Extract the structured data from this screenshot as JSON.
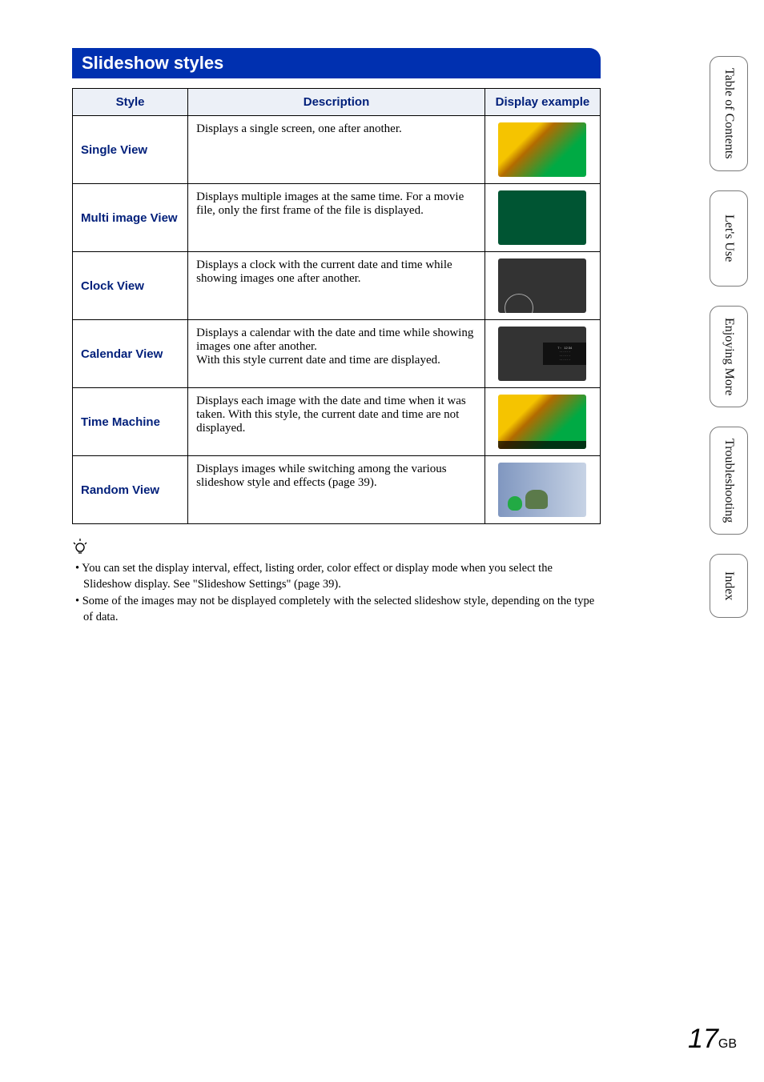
{
  "section_title": "Slideshow styles",
  "table": {
    "headers": {
      "style": "Style",
      "description": "Description",
      "example": "Display example"
    },
    "rows": [
      {
        "style": "Single View",
        "description": "Displays a single screen, one after another.",
        "thumb": "sunflower"
      },
      {
        "style": "Multi image View",
        "description": "Displays multiple images at the same time. For a movie file, only the first frame of the file is displayed.",
        "thumb": "multi"
      },
      {
        "style": "Clock View",
        "description": "Displays a clock with the current date and time while showing images one after another.",
        "thumb": "clock"
      },
      {
        "style": "Calendar View",
        "description": "Displays a calendar with the date and time while showing images one after another.\nWith this style current date and time are displayed.",
        "thumb": "calendar"
      },
      {
        "style": "Time Machine",
        "description": "Displays each image with the date and time when it was taken. With this style, the current date and time are not displayed.",
        "thumb": "time"
      },
      {
        "style": "Random View",
        "description": "Displays images while switching among the various slideshow style and effects (page 39).",
        "thumb": "random"
      }
    ]
  },
  "tips": {
    "icon": "tip-icon",
    "items": [
      "You can set the display interval, effect, listing order, color effect or display mode when you select the Slideshow display. See \"Slideshow Settings\" (page 39).",
      "Some of the images may not be displayed completely with the selected slideshow style, depending on the type of data."
    ]
  },
  "sidebar": {
    "tabs": [
      {
        "label": "Table of Contents",
        "key": "toc"
      },
      {
        "label": "Let's Use",
        "key": "lets-use"
      },
      {
        "label": "Enjoying More",
        "key": "enjoying"
      },
      {
        "label": "Troubleshooting",
        "key": "troubleshooting"
      },
      {
        "label": "Index",
        "key": "index"
      }
    ]
  },
  "page_number": {
    "num": "17",
    "suffix": "GB"
  }
}
